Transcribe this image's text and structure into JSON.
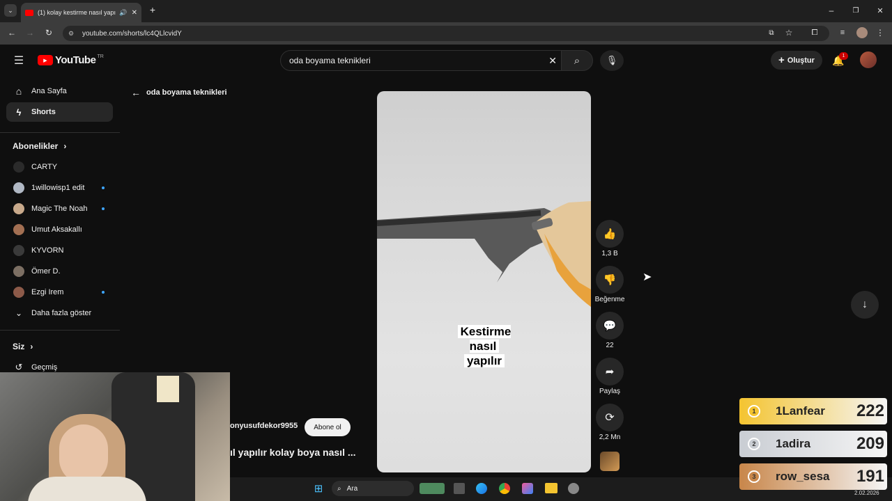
{
  "browser": {
    "tab_title": "(1) kolay kestirme nasıl yapı",
    "url": "youtube.com/shorts/lc4QLlcvidY"
  },
  "header": {
    "logo_text": "YouTube",
    "region": "TR",
    "search_value": "oda boyama teknikleri",
    "create_label": "Oluştur",
    "notif_count": "1"
  },
  "sidebar": {
    "home": "Ana Sayfa",
    "shorts": "Shorts",
    "subs_heading": "Abonelikler",
    "channels": [
      {
        "name": "CARTY",
        "dot": false
      },
      {
        "name": "1willowisp1 edit",
        "dot": true
      },
      {
        "name": "Magic The Noah",
        "dot": true
      },
      {
        "name": "Umut Aksakallı",
        "dot": false
      },
      {
        "name": "KYVORN",
        "dot": false
      },
      {
        "name": "Ömer D.",
        "dot": false
      },
      {
        "name": "Ezgi Irem",
        "dot": true
      }
    ],
    "show_more": "Daha fazla göster",
    "you_heading": "Siz",
    "history": "Geçmiş"
  },
  "back": {
    "label": "oda boyama teknikleri"
  },
  "short": {
    "caption_line1": "Kestirme nasıl",
    "caption_line2": "yapılır",
    "channel": "onyusufdekor9955",
    "subscribe_label": "Abone ol",
    "title": "ıl yapılır kolay boya nasıl ..."
  },
  "actions": {
    "likes": "1,3 B",
    "dislike": "Beğenme",
    "comments": "22",
    "share": "Paylaş",
    "remix": "2,2 Mn"
  },
  "leaderboard": [
    {
      "rank": "1",
      "name": "1Lanfear",
      "score": "222",
      "color": "#f4c430"
    },
    {
      "rank": "2",
      "name": "1adira",
      "score": "209",
      "color": "#c9cdd3"
    },
    {
      "rank": "3",
      "name": "row_sesa",
      "score": "191",
      "color": "#c8864a"
    }
  ],
  "taskbar": {
    "search_label": "Ara",
    "date": "2.02.2026"
  }
}
